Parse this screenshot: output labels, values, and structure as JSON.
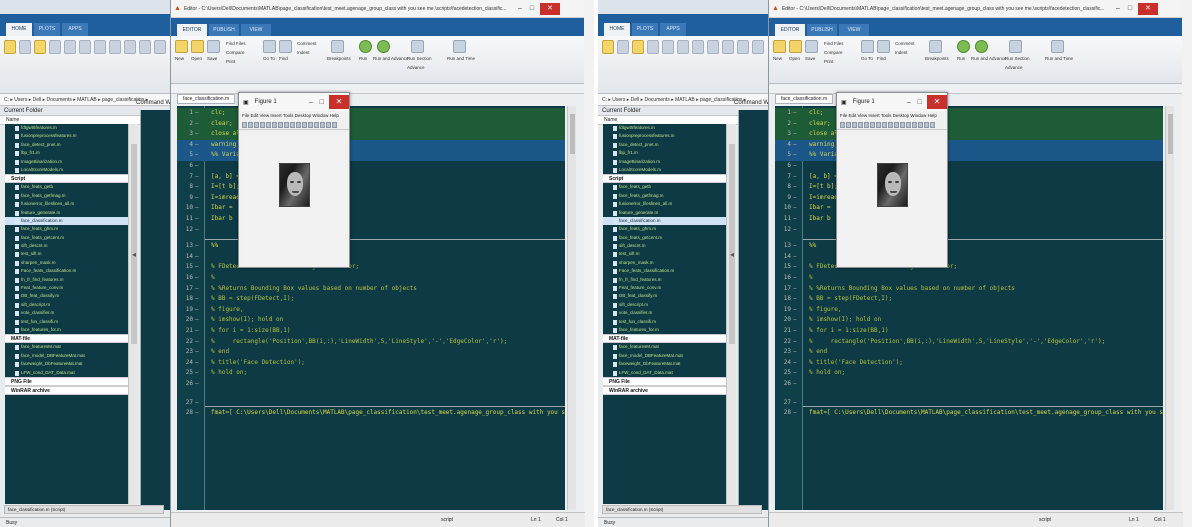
{
  "matlab": {
    "main_tabs": [
      "HOME",
      "PLOTS",
      "APPS"
    ],
    "path_text": "C: ▸ Users ▸ Dell ▸ Documents ▸ MATLAB ▸ page_classification ▸",
    "current_folder_label": "Current Folder",
    "command_window_label": "Command W",
    "name_column": "Name",
    "folder_groups": [
      {
        "label": "",
        "files": [
          "fdtgwt5features.m",
          "fusionpreprocessfeatures.m",
          "face_detect_pnet.m",
          "lbp_fr1.m",
          "ImageBinarization.m",
          "LocalScoreModels.m"
        ]
      },
      {
        "label": "Script",
        "files": [
          "face_feats_getb",
          "face_feats_getfmag.m",
          "fusionerror_fileslines_all.m",
          "feature_generate.m"
        ]
      },
      {
        "label": "",
        "files": [
          "face_classification.m"
        ],
        "selected": 0
      },
      {
        "label": "",
        "files": [
          "face_feats_ghm.m",
          "face_feats_getcent.m",
          "sift_descnt.m",
          "test_sift.m",
          "sharpen_mask.m",
          "Face_feats_classification.m",
          "fn_fr_find_features.m",
          "Feat_feature_conv.m",
          "DB_feat_classify.m",
          "sift_descript.m",
          "vote_classifier.m",
          "test_fun_classifi.m",
          "face_features_for.m"
        ]
      },
      {
        "label": "MAT-file",
        "files": [
          "face_featuresM.mat",
          "face_model_DBFeatureMat.mat",
          "faceweight_DbFeatureMat.mat",
          "LFW_cond_DAT_Data.mat"
        ]
      },
      {
        "label": "PNG File",
        "files": []
      },
      {
        "label": "WinRAR archive",
        "files": []
      }
    ],
    "bottom_bar_text": "face_classification.m (Script)",
    "status_text": "Busy"
  },
  "editor": {
    "window_title": "Editor - C:\\Users\\Dell\\Documents\\MATLAB\\page_classification\\test_meet.agenage_group_class with you see me.\\scripts\\facedetection_classific...",
    "tabs": [
      "EDITOR",
      "PUBLISH",
      "VIEW"
    ],
    "file_tab": "face_classification.m",
    "ribbon_labels": [
      "New",
      "Open",
      "Save",
      "Compare",
      "Print",
      "Find Files",
      "Go To",
      "Find",
      "Comment",
      "Indent",
      "Breakpoints",
      "Run",
      "Run and Advance",
      "Run Section",
      "Advance",
      "Run and Time"
    ],
    "code_lines": [
      {
        "n": "1",
        "text": "clc;",
        "hl": "green"
      },
      {
        "n": "2",
        "text": "clear;",
        "hl": "green"
      },
      {
        "n": "3",
        "text": "close all",
        "hl": "green"
      },
      {
        "n": "4",
        "text": "warning off",
        "hl": "blue"
      },
      {
        "n": "5",
        "text": "%% Variab",
        "hl": "blue"
      },
      {
        "n": "6",
        "text": ""
      },
      {
        "n": "7",
        "text": "[a, b] = "
      },
      {
        "n": "8",
        "text": "I=[t b];"
      },
      {
        "n": "9",
        "text": "I=imread"
      },
      {
        "n": "10",
        "text": "Ibar ="
      },
      {
        "n": "11",
        "text": "Ibar b"
      },
      {
        "n": "12",
        "text": ""
      },
      {
        "n": "13",
        "text": "%%",
        "section": true
      },
      {
        "n": "14",
        "text": ""
      },
      {
        "n": "15",
        "text": "% FDetect = vision.CascadeObjectDetector;",
        "comment": true
      },
      {
        "n": "16",
        "text": "%",
        "comment": true
      },
      {
        "n": "17",
        "text": "% %Returns Bounding Box values based on number of objects",
        "comment": true
      },
      {
        "n": "18",
        "text": "% BB = step(FDetect,I);",
        "comment": true
      },
      {
        "n": "19",
        "text": "% figure,",
        "comment": true
      },
      {
        "n": "20",
        "text": "% imshow(I); hold on",
        "comment": true
      },
      {
        "n": "21",
        "text": "% for i = 1:size(BB,1)",
        "comment": true
      },
      {
        "n": "22",
        "text": "%     rectangle('Position',BB(i,:),'LineWidth',5,'LineStyle','-','EdgeColor','r');",
        "comment": true
      },
      {
        "n": "23",
        "text": "% end",
        "comment": true
      },
      {
        "n": "24",
        "text": "% title('Face Detection');",
        "comment": true
      },
      {
        "n": "25",
        "text": "% hold on;",
        "comment": true
      },
      {
        "n": "26",
        "text": ""
      },
      {
        "n": "27",
        "text": ""
      },
      {
        "n": "28",
        "text": "fmat=[ C:\\Users\\Dell\\Documents\\MATLAB\\page_classification\\test_meet.agenage_group_class with you see me.pac\\LoadFac",
        "section": true
      }
    ],
    "status_items": [
      "script",
      "Ln 1",
      "Col 1"
    ]
  },
  "figure": {
    "title": "Figure 1",
    "menu": "File  Edit  View  Insert  Tools  Desktop  Window  Help",
    "image_subject": "grayscale face photograph"
  },
  "colors": {
    "code_bg": "#0d3a44",
    "code_text": "#d8d84a",
    "highlight_green": "#1d5c36",
    "highlight_blue": "#1b5788",
    "ribbon_tab_bg": "#1f5f9e",
    "close_red": "#c9302c"
  }
}
